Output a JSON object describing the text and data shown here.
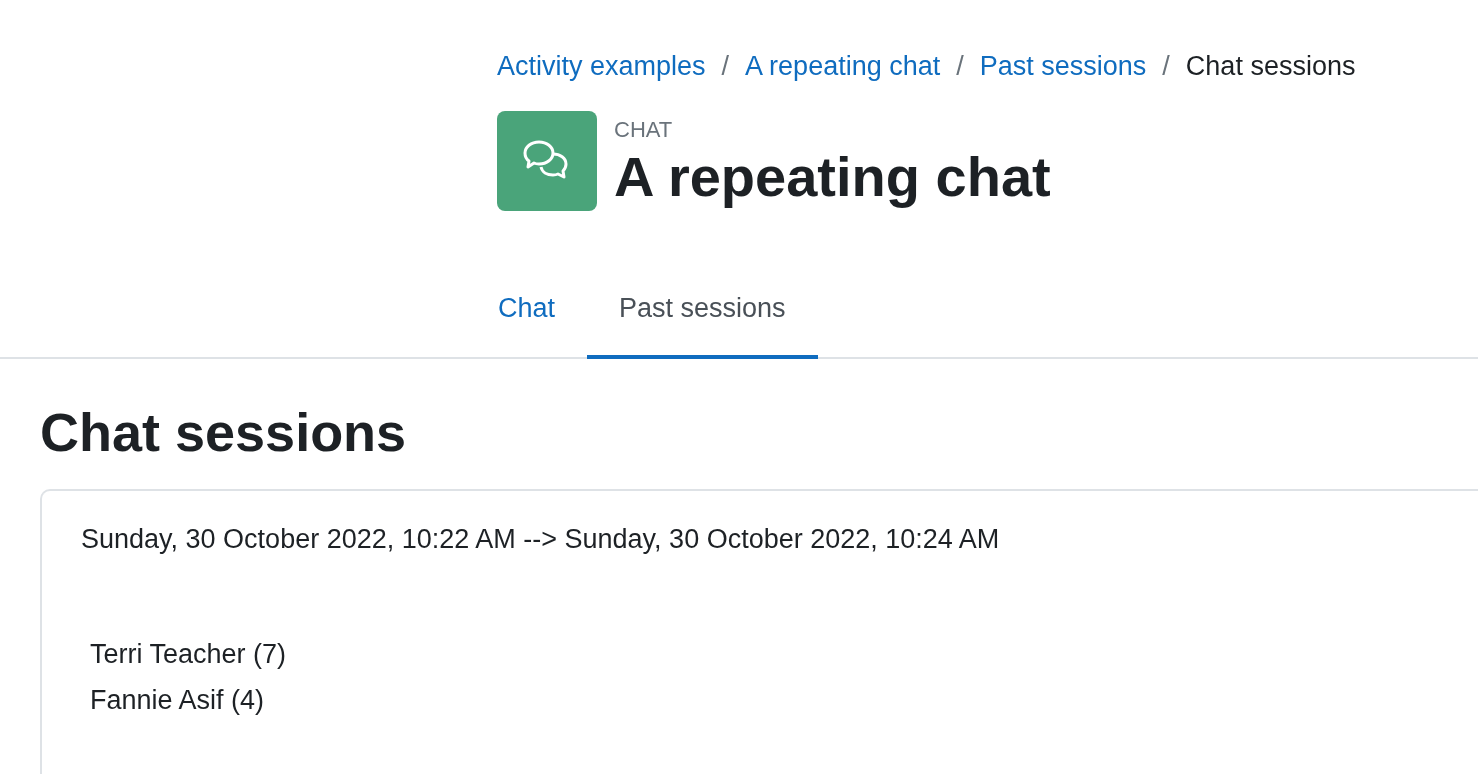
{
  "breadcrumb_separator": "/",
  "breadcrumb": [
    {
      "label": "Activity examples",
      "current": false
    },
    {
      "label": "A repeating chat",
      "current": false
    },
    {
      "label": "Past sessions",
      "current": false
    },
    {
      "label": "Chat sessions",
      "current": true
    }
  ],
  "header": {
    "module": "CHAT",
    "title": "A repeating chat"
  },
  "tabs": [
    {
      "label": "Chat",
      "selected": false
    },
    {
      "label": "Past sessions",
      "selected": true
    }
  ],
  "heading": "Chat sessions",
  "sessions": [
    {
      "time_range": "Sunday, 30 October 2022, 10:22 AM --> Sunday, 30 October 2022, 10:24 AM",
      "users": [
        "Terri Teacher (7)",
        "Fannie Asif (4)"
      ]
    }
  ]
}
